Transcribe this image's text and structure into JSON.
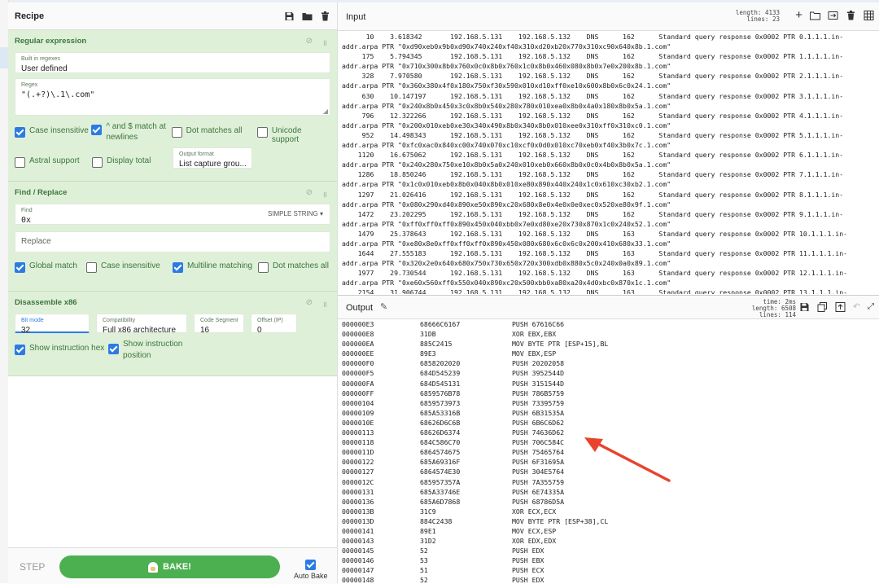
{
  "recipe": {
    "title": "Recipe",
    "icons": [
      "save-icon",
      "folder-icon",
      "trash-icon"
    ],
    "regex": {
      "title": "Regular expression",
      "builtin_label": "Built in regexes",
      "builtin_value": "User defined",
      "regex_label": "Regex",
      "regex_value": "\"(.+?)\\.1\\.com\"",
      "checks": [
        {
          "label": "Case insensitive",
          "checked": true
        },
        {
          "label": "^ and $ match at newlines",
          "checked": true
        },
        {
          "label": "Dot matches all",
          "checked": false
        },
        {
          "label": "Unicode support",
          "checked": false
        },
        {
          "label": "Astral support",
          "checked": false
        },
        {
          "label": "Display total",
          "checked": false
        }
      ],
      "output_format_label": "Output format",
      "output_format_value": "List capture grou..."
    },
    "find_replace": {
      "title": "Find / Replace",
      "find_label": "Find",
      "find_value": "0x",
      "find_mode": "SIMPLE STRING",
      "replace_placeholder": "Replace",
      "checks": [
        {
          "label": "Global match",
          "checked": true
        },
        {
          "label": "Case insensitive",
          "checked": false
        },
        {
          "label": "Multiline matching",
          "checked": true
        },
        {
          "label": "Dot matches all",
          "checked": false
        }
      ]
    },
    "disassemble": {
      "title": "Disassemble x86",
      "bitmode_label": "Bit mode",
      "bitmode_value": "32",
      "compat_label": "Compatibility",
      "compat_value": "Full x86 architecture",
      "codeseg_label": "Code Segment (...",
      "codeseg_value": "16",
      "offset_label": "Offset (IP)",
      "offset_value": "0",
      "checks": [
        {
          "label": "Show instruction hex",
          "checked": true
        },
        {
          "label": "Show instruction position",
          "checked": true
        }
      ]
    },
    "step_label": "STEP",
    "bake_label": "BAKE!",
    "autobake_label": "Auto Bake"
  },
  "input": {
    "title": "Input",
    "length_label": "length:",
    "length_value": "4133",
    "lines_label": "lines:",
    "lines_value": "23",
    "rows": [
      {
        "no": "10",
        "time": "3.618342",
        "src": "192.168.5.131",
        "dst": "192.168.5.132",
        "proto": "DNS",
        "len": "162",
        "info": "Standard query response 0x0002 PTR 0.1.1.1.in-",
        "cont": "addr.arpa PTR \"0xd90xeb0x9b0xd90x740x240xf40x310xd20xb20x770x310xc90x640x8b.1.com\""
      },
      {
        "no": "175",
        "time": "5.794345",
        "src": "192.168.5.131",
        "dst": "192.168.5.132",
        "proto": "DNS",
        "len": "162",
        "info": "Standard query response 0x0002 PTR 1.1.1.1.in-",
        "cont": "addr.arpa PTR \"0x710x300x8b0x760x0c0x8b0x760x1c0x8b0x460x080x8b0x7e0x200x8b.1.com\""
      },
      {
        "no": "328",
        "time": "7.970580",
        "src": "192.168.5.131",
        "dst": "192.168.5.132",
        "proto": "DNS",
        "len": "162",
        "info": "Standard query response 0x0002 PTR 2.1.1.1.in-",
        "cont": "addr.arpa PTR \"0x360x380x4f0x180x750xf30x590x010xd10xff0xe10x600x8b0x6c0x24.1.com\""
      },
      {
        "no": "630",
        "time": "10.147197",
        "src": "192.168.5.131",
        "dst": "192.168.5.132",
        "proto": "DNS",
        "len": "162",
        "info": "Standard query response 0x0002 PTR 3.1.1.1.in-",
        "cont": "addr.arpa PTR \"0x240x8b0x450x3c0x8b0x540x280x780x010xea0x8b0x4a0x180x8b0x5a.1.com\""
      },
      {
        "no": "796",
        "time": "12.322266",
        "src": "192.168.5.131",
        "dst": "192.168.5.132",
        "proto": "DNS",
        "len": "162",
        "info": "Standard query response 0x0002 PTR 4.1.1.1.in-",
        "cont": "addr.arpa PTR \"0x200x010xeb0xe30x340x490x8b0x340x8b0x010xee0x310xff0x310xc0.1.com\""
      },
      {
        "no": "952",
        "time": "14.498343",
        "src": "192.168.5.131",
        "dst": "192.168.5.132",
        "proto": "DNS",
        "len": "162",
        "info": "Standard query response 0x0002 PTR 5.1.1.1.in-",
        "cont": "addr.arpa PTR \"0xfc0xac0x840xc00x740x070xc10xcf0x0d0x010xc70xeb0xf40x3b0x7c.1.com\""
      },
      {
        "no": "1120",
        "time": "16.675062",
        "src": "192.168.5.131",
        "dst": "192.168.5.132",
        "proto": "DNS",
        "len": "162",
        "info": "Standard query response 0x0002 PTR 6.1.1.1.in-",
        "cont": "addr.arpa PTR \"0x240x280x750xe10x8b0x5a0x240x010xeb0x660x8b0x0c0x4b0x8b0x5a.1.com\""
      },
      {
        "no": "1286",
        "time": "18.850246",
        "src": "192.168.5.131",
        "dst": "192.168.5.132",
        "proto": "DNS",
        "len": "162",
        "info": "Standard query response 0x0002 PTR 7.1.1.1.in-",
        "cont": "addr.arpa PTR \"0x1c0x010xeb0x8b0x040x8b0x010xe80x890x440x240x1c0x610xc30xb2.1.com\""
      },
      {
        "no": "1297",
        "time": "21.026416",
        "src": "192.168.5.131",
        "dst": "192.168.5.132",
        "proto": "DNS",
        "len": "162",
        "info": "Standard query response 0x0002 PTR 8.1.1.1.in-",
        "cont": "addr.arpa PTR \"0x080x290xd40x890xe50x890xc20x680x8e0x4e0x0e0xec0x520xe80x9f.1.com\""
      },
      {
        "no": "1472",
        "time": "23.202295",
        "src": "192.168.5.131",
        "dst": "192.168.5.132",
        "proto": "DNS",
        "len": "162",
        "info": "Standard query response 0x0002 PTR 9.1.1.1.in-",
        "cont": "addr.arpa PTR \"0xff0xff0xff0x890x450x040xbb0x7e0xd80xe20x730x870x1c0x240x52.1.com\""
      },
      {
        "no": "1479",
        "time": "25.378643",
        "src": "192.168.5.131",
        "dst": "192.168.5.132",
        "proto": "DNS",
        "len": "163",
        "info": "Standard query response 0x0002 PTR 10.1.1.1.in-",
        "cont": "addr.arpa PTR \"0xe80x8e0xff0xff0xff0x890x450x080x680x6c0x6c0x200x410x680x33.1.com\""
      },
      {
        "no": "1644",
        "time": "27.555183",
        "src": "192.168.5.131",
        "dst": "192.168.5.132",
        "proto": "DNS",
        "len": "163",
        "info": "Standard query response 0x0002 PTR 11.1.1.1.in-",
        "cont": "addr.arpa PTR \"0x320x2e0x640x680x750x730x650x720x300xdb0x880x5c0x240x0a0x89.1.com\""
      },
      {
        "no": "1977",
        "time": "29.730544",
        "src": "192.168.5.131",
        "dst": "192.168.5.132",
        "proto": "DNS",
        "len": "163",
        "info": "Standard query response 0x0002 PTR 12.1.1.1.in-",
        "cont": "addr.arpa PTR \"0xe60x560xff0x550x040x890xc20x500xbb0xa80xa20x4d0xbc0x870x1c.1.com\""
      },
      {
        "no": "2154",
        "time": "31.906744",
        "src": "192.168.5.131",
        "dst": "192.168.5.132",
        "proto": "DNS",
        "len": "163",
        "info": "Standard query response 0x0002 PTR 13.1.1.1.in-",
        "cont": ""
      }
    ]
  },
  "output": {
    "title": "Output",
    "time_label": "time:",
    "time_value": "2ms",
    "length_label": "length:",
    "length_value": "6508",
    "lines_label": "lines:",
    "lines_value": "114",
    "rows": [
      [
        "000000E3",
        "68666C6167",
        "PUSH 67616C66"
      ],
      [
        "000000E8",
        "31DB",
        "XOR EBX,EBX"
      ],
      [
        "000000EA",
        "885C2415",
        "MOV BYTE PTR [ESP+15],BL"
      ],
      [
        "000000EE",
        "89E3",
        "MOV EBX,ESP"
      ],
      [
        "000000F0",
        "6858202020",
        "PUSH 20202058"
      ],
      [
        "000000F5",
        "684D545239",
        "PUSH 3952544D"
      ],
      [
        "000000FA",
        "684D545131",
        "PUSH 3151544D"
      ],
      [
        "000000FF",
        "6859576B78",
        "PUSH 786B5759"
      ],
      [
        "00000104",
        "6859573973",
        "PUSH 73395759"
      ],
      [
        "00000109",
        "685A53316B",
        "PUSH 6B31535A"
      ],
      [
        "0000010E",
        "68626D6C6B",
        "PUSH 6B6C6D62"
      ],
      [
        "00000113",
        "68626D6374",
        "PUSH 74636D62"
      ],
      [
        "00000118",
        "684C586C70",
        "PUSH 706C584C"
      ],
      [
        "0000011D",
        "6864574675",
        "PUSH 75465764"
      ],
      [
        "00000122",
        "685A69316F",
        "PUSH 6F31695A"
      ],
      [
        "00000127",
        "6864574E30",
        "PUSH 304E5764"
      ],
      [
        "0000012C",
        "685957357A",
        "PUSH 7A355759"
      ],
      [
        "00000131",
        "685A33746E",
        "PUSH 6E74335A"
      ],
      [
        "00000136",
        "685A6D7868",
        "PUSH 68786D5A"
      ],
      [
        "0000013B",
        "31C9",
        "XOR ECX,ECX"
      ],
      [
        "0000013D",
        "884C2438",
        "MOV BYTE PTR [ESP+38],CL"
      ],
      [
        "00000141",
        "89E1",
        "MOV ECX,ESP"
      ],
      [
        "00000143",
        "31D2",
        "XOR EDX,EDX"
      ],
      [
        "00000145",
        "52",
        "PUSH EDX"
      ],
      [
        "00000146",
        "53",
        "PUSH EBX"
      ],
      [
        "00000147",
        "51",
        "PUSH ECX"
      ],
      [
        "00000148",
        "52",
        "PUSH EDX"
      ]
    ]
  },
  "colors": {
    "accent": "#2c7be5",
    "op_bg": "#dff0d8",
    "op_text": "#3c763d",
    "bake": "#4caf50",
    "arrow": "#e8432e"
  }
}
